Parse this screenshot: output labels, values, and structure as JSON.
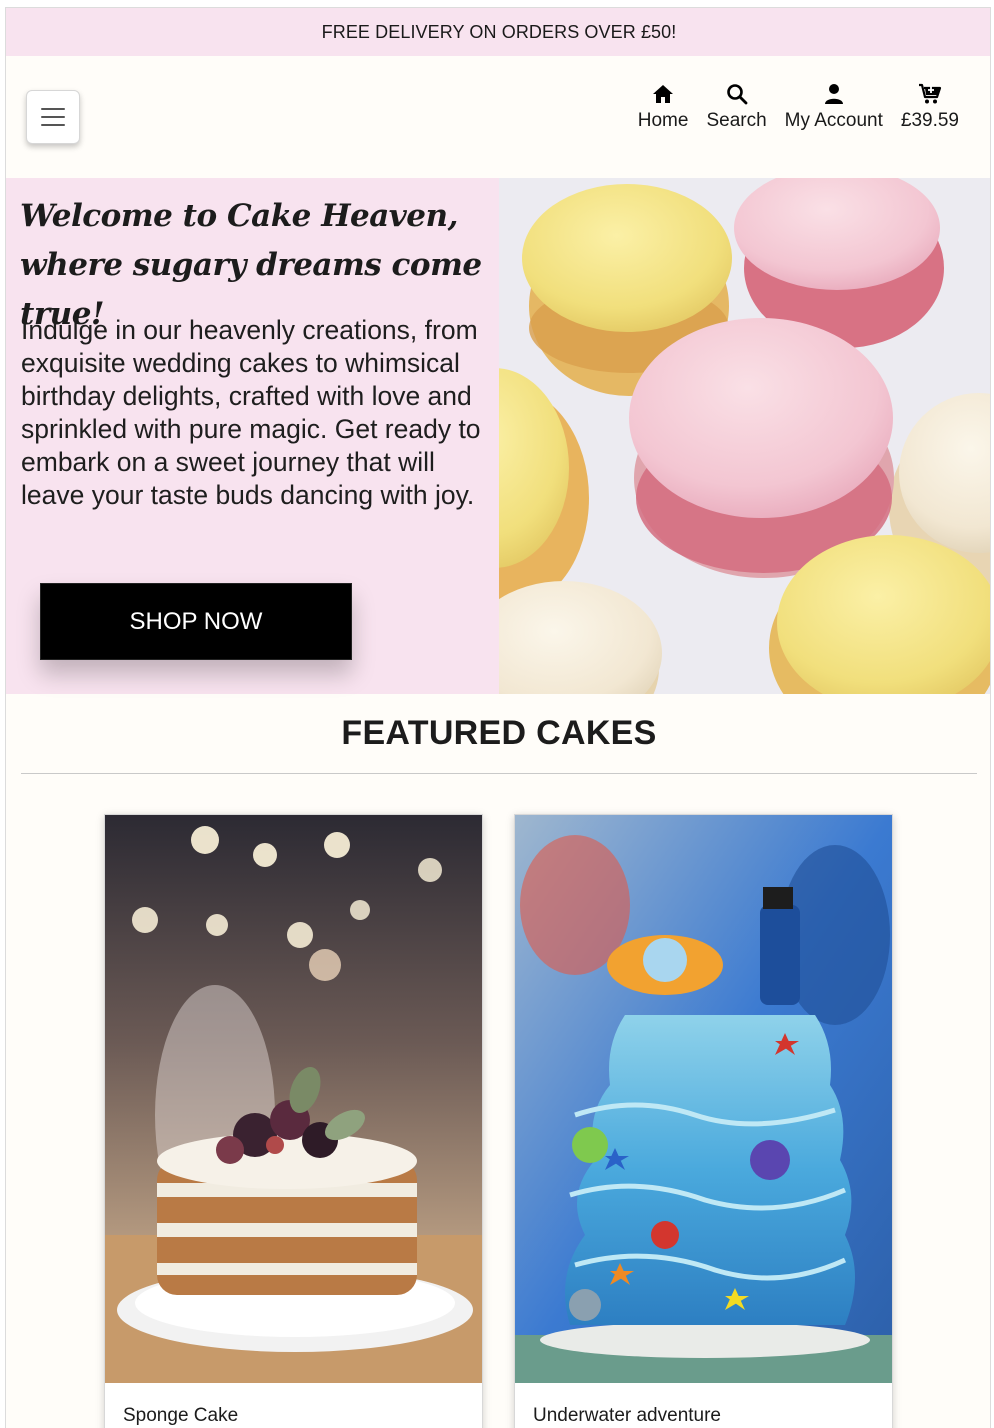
{
  "banner": {
    "text": "FREE DELIVERY ON ORDERS OVER £50!"
  },
  "header": {
    "menu_icon": "hamburger-menu-icon",
    "nav": [
      {
        "label": "Home",
        "icon": "home-icon"
      },
      {
        "label": "Search",
        "icon": "search-icon"
      },
      {
        "label": "My Account",
        "icon": "user-icon"
      },
      {
        "label": "£39.59",
        "icon": "cart-icon"
      }
    ]
  },
  "hero": {
    "title": "Welcome to Cake Heaven, where sugary dreams come true!",
    "text": "Indulge in our heavenly creations, from exquisite wedding cakes to whimsical birthday delights, crafted with love and sprinkled with pure magic. Get ready to embark on a sweet journey that will leave your taste buds dancing with joy.",
    "button": "SHOP NOW",
    "background_color": "#f8e3ef"
  },
  "featured": {
    "title": "FEATURED CAKES",
    "cards": [
      {
        "title": "Sponge Cake"
      },
      {
        "title": "Underwater adventure"
      }
    ]
  }
}
